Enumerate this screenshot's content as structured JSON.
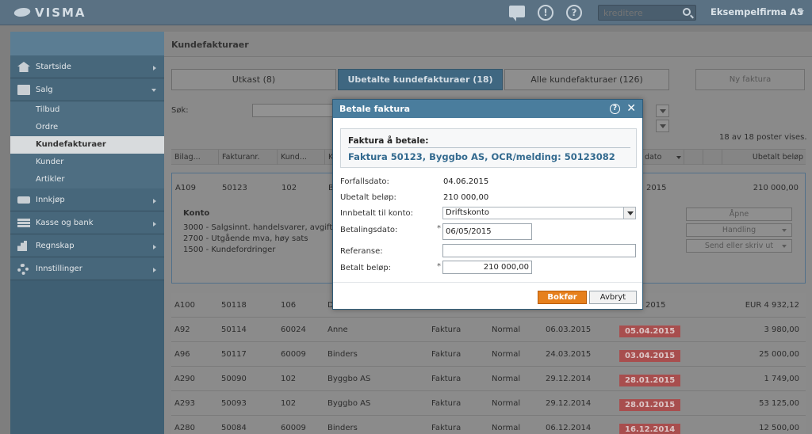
{
  "topbar": {
    "brand": "VISMA",
    "search_placeholder": "kreditere",
    "company": "Eksempelfirma AS",
    "help_icon_glyph": "?",
    "alert_icon_glyph": "!"
  },
  "sidebar": {
    "items": [
      {
        "label": "Startside",
        "icon": "home-icon"
      },
      {
        "label": "Salg",
        "icon": "book-icon"
      },
      {
        "label": "Innkjøp",
        "icon": "cart-icon"
      },
      {
        "label": "Kasse og bank",
        "icon": "transfer-icon"
      },
      {
        "label": "Regnskap",
        "icon": "chart-icon"
      },
      {
        "label": "Innstillinger",
        "icon": "gear-icon"
      }
    ],
    "salg_sub": [
      "Tilbud",
      "Ordre",
      "Kundefakturaer",
      "Kunder",
      "Artikler"
    ],
    "active_sub": "Kundefakturaer"
  },
  "main": {
    "title": "Kundefakturaer",
    "tabs": [
      "Utkast (8)",
      "Ubetalte kundefakturaer (18)",
      "Alle kundefakturaer (126)"
    ],
    "new_invoice": "Ny faktura",
    "search_label": "Søk:",
    "count_text": "18 av 18 poster vises.",
    "columns": [
      "Bilag...",
      "Fakturanr.",
      "Kund...",
      "K",
      "dato",
      "Ubetalt beløp"
    ],
    "expanded": {
      "bilag": "A109",
      "fakturanr": "50123",
      "kunde": "102",
      "navn_start": "B",
      "due": "2015",
      "amount": "210 000,00",
      "konto_title": "Konto",
      "konto_lines": [
        "3000 - Salgsinnt. handelsvarer, avgifts",
        "2700 - Utgående mva, høy sats",
        "1500 - Kundefordringer"
      ],
      "buttons": [
        "Åpne",
        "Handling",
        "Send eller skriv ut"
      ]
    },
    "rows": [
      {
        "bilag": "A100",
        "nr": "50118",
        "kunde": "106",
        "navn": "D",
        "type": "",
        "status": "",
        "dato": "",
        "forfall": "2015",
        "amount": "EUR 4 932,12",
        "overdue": false
      },
      {
        "bilag": "A92",
        "nr": "50114",
        "kunde": "60024",
        "navn": "Anne",
        "type": "Faktura",
        "status": "Normal",
        "dato": "06.03.2015",
        "forfall": "05.04.2015",
        "amount": "3 980,00",
        "overdue": true
      },
      {
        "bilag": "A96",
        "nr": "50117",
        "kunde": "60009",
        "navn": "Binders",
        "type": "Faktura",
        "status": "Normal",
        "dato": "24.03.2015",
        "forfall": "03.04.2015",
        "amount": "25 000,00",
        "overdue": true
      },
      {
        "bilag": "A290",
        "nr": "50090",
        "kunde": "102",
        "navn": "Byggbo AS",
        "type": "Faktura",
        "status": "Normal",
        "dato": "29.12.2014",
        "forfall": "28.01.2015",
        "amount": "1 749,00",
        "overdue": true
      },
      {
        "bilag": "A293",
        "nr": "50093",
        "kunde": "102",
        "navn": "Byggbo AS",
        "type": "Faktura",
        "status": "Normal",
        "dato": "29.12.2014",
        "forfall": "28.01.2015",
        "amount": "53 125,00",
        "overdue": true
      },
      {
        "bilag": "A280",
        "nr": "50084",
        "kunde": "60009",
        "navn": "Binders",
        "type": "Faktura",
        "status": "Normal",
        "dato": "06.12.2014",
        "forfall": "16.12.2014",
        "amount": "12 500,00",
        "overdue": true
      }
    ]
  },
  "dialog": {
    "title": "Betale faktura",
    "box_title": "Faktura å betale:",
    "box_ref": "Faktura 50123, Byggbo AS, OCR/melding: 50123082",
    "forfall_label": "Forfallsdato:",
    "forfall_value": "04.06.2015",
    "ubetalt_label": "Ubetalt beløp:",
    "ubetalt_value": "210 000,00",
    "konto_label": "Innbetalt til konto:",
    "konto_value": "Driftskonto",
    "betalingsdato_label": "Betalingsdato:",
    "betalingsdato_value": "06/05/2015",
    "referanse_label": "Referanse:",
    "referanse_value": "",
    "betalt_label": "Betalt beløp:",
    "betalt_value": "210 000,00",
    "required_mark": "*",
    "bokfor": "Bokfør",
    "avbryt": "Avbryt"
  },
  "colors": {
    "accent": "#4a7d9d",
    "overdue": "#a84e4e",
    "primary_button": "#e6801d"
  }
}
